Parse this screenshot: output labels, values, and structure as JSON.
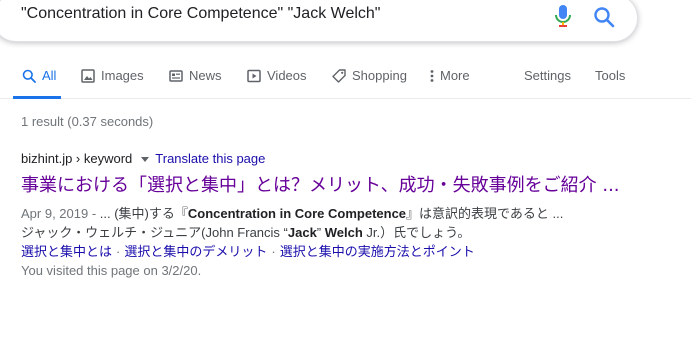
{
  "search": {
    "query": "\"Concentration in Core Competence\" \"Jack Welch\""
  },
  "tabs": [
    {
      "label": "All",
      "icon": "search-icon",
      "active": true
    },
    {
      "label": "Images",
      "icon": "image-icon"
    },
    {
      "label": "News",
      "icon": "news-icon"
    },
    {
      "label": "Videos",
      "icon": "play-icon"
    },
    {
      "label": "Shopping",
      "icon": "tag-icon"
    },
    {
      "label": "More",
      "icon": "more-vertical-icon"
    }
  ],
  "tools": {
    "settings": "Settings",
    "tools": "Tools"
  },
  "stats": "1 result (0.37 seconds)",
  "result": {
    "cite": "bizhint.jp › keyword",
    "translate": "Translate this page",
    "title": "事業における「選択と集中」とは？メリット、成功・失敗事例をご紹介 ...",
    "date": "Apr 9, 2019 - ",
    "snippet_1a": "... (集中)する『",
    "snippet_1b": "Concentration in Core Competence",
    "snippet_1c": "』は意訳的表現であると ...",
    "snippet_2a": "ジャック・ウェルチ・ジュニア(John Francis “",
    "snippet_2b": "Jack",
    "snippet_2c": "” ",
    "snippet_2d": "Welch",
    "snippet_2e": " Jr.）氏でしょう。",
    "sitelinks": [
      "選択と集中とは",
      "選択と集中のデメリット",
      "選択と集中の実施方法とポイント"
    ],
    "sitelink_separator": "·",
    "visited": "You visited this page on 3/2/20."
  },
  "colors": {
    "accent": "#1a73e8",
    "link": "#1a0dab",
    "visited_link": "#660099",
    "meta": "#70757a"
  }
}
